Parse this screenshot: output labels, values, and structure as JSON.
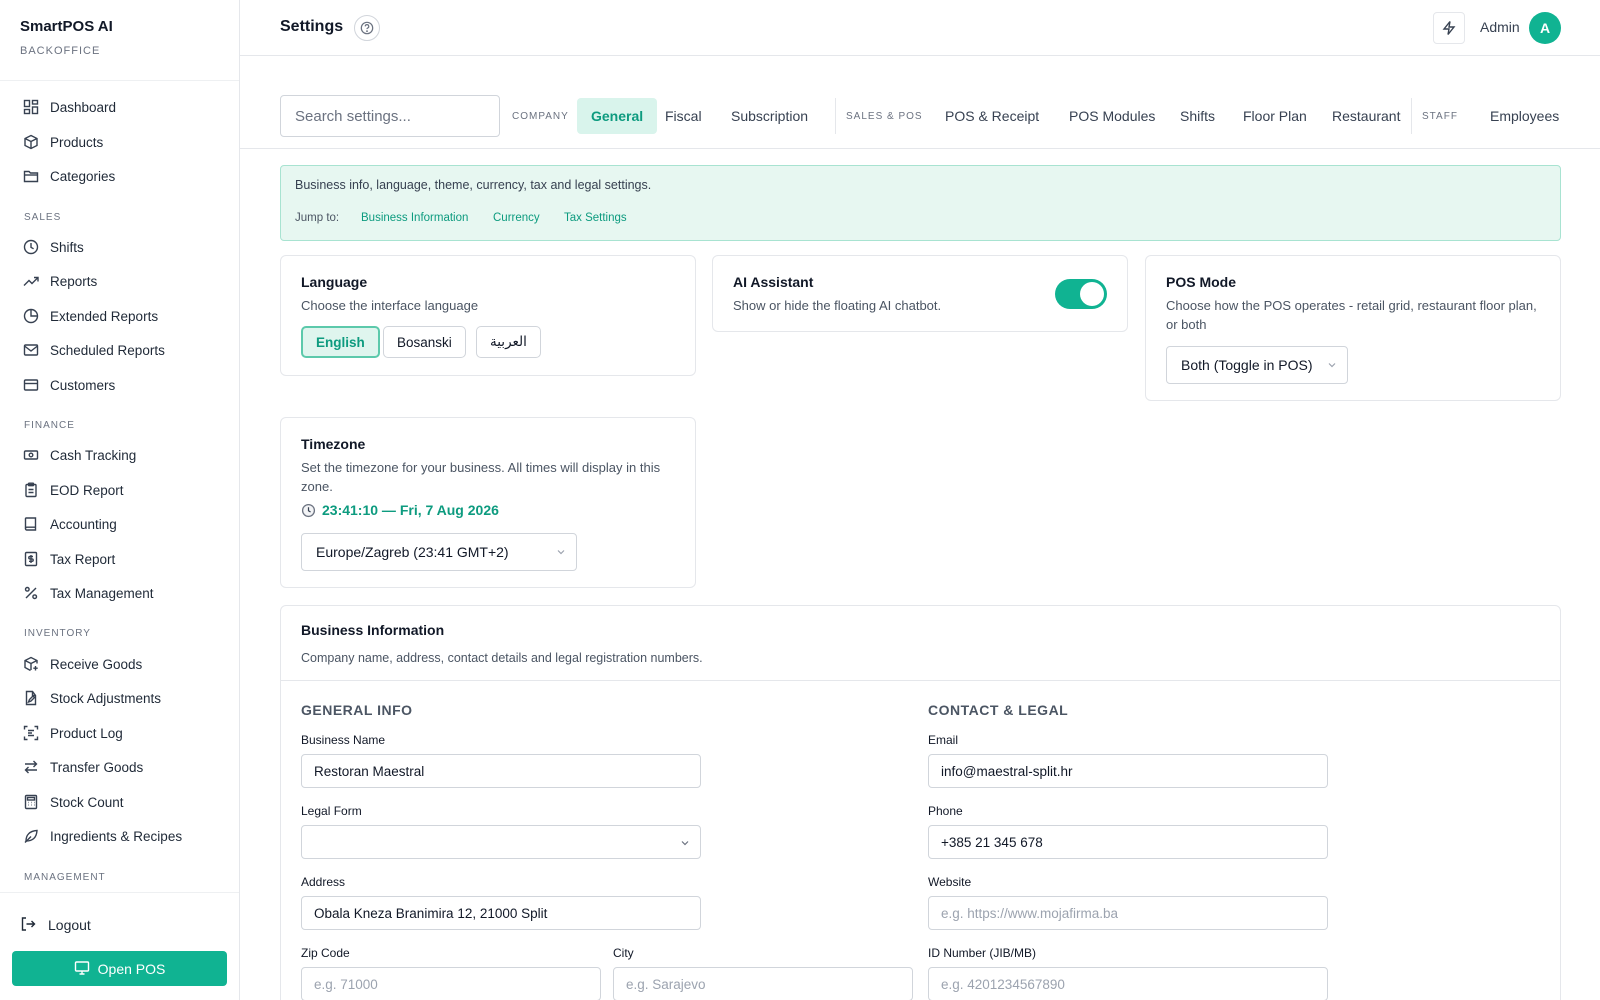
{
  "brand": {
    "title": "SmartPOS AI",
    "subtitle": "BACKOFFICE"
  },
  "sidebar": {
    "items": [
      {
        "label": "Dashboard",
        "icon": "dashboard-icon"
      },
      {
        "label": "Products",
        "icon": "box-icon"
      },
      {
        "label": "Categories",
        "icon": "folder-icon"
      },
      {
        "label": "Shifts",
        "icon": "clock-icon"
      },
      {
        "label": "Reports",
        "icon": "trending-up-icon"
      },
      {
        "label": "Extended Reports",
        "icon": "pie-chart-icon"
      },
      {
        "label": "Scheduled Reports",
        "icon": "mail-icon"
      },
      {
        "label": "Customers",
        "icon": "card-icon"
      },
      {
        "label": "Cash Tracking",
        "icon": "banknote-icon"
      },
      {
        "label": "EOD Report",
        "icon": "clipboard-icon"
      },
      {
        "label": "Accounting",
        "icon": "book-icon"
      },
      {
        "label": "Tax Report",
        "icon": "dollar-file-icon"
      },
      {
        "label": "Tax Management",
        "icon": "percent-icon"
      },
      {
        "label": "Receive Goods",
        "icon": "package-plus-icon"
      },
      {
        "label": "Stock Adjustments",
        "icon": "file-edit-icon"
      },
      {
        "label": "Product Log",
        "icon": "scan-text-icon"
      },
      {
        "label": "Transfer Goods",
        "icon": "arrows-icon"
      },
      {
        "label": "Stock Count",
        "icon": "calculator-icon"
      },
      {
        "label": "Ingredients & Recipes",
        "icon": "leaf-icon"
      }
    ],
    "sections": {
      "sales": "SALES",
      "finance": "FINANCE",
      "inventory": "INVENTORY",
      "management": "MANAGEMENT"
    },
    "logout": "Logout",
    "open_pos": "Open POS"
  },
  "header": {
    "title": "Settings",
    "user": "Admin",
    "avatar_initial": "A"
  },
  "search": {
    "placeholder": "Search settings..."
  },
  "tabs": {
    "company_label": "COMPANY",
    "sales_label": "SALES & POS",
    "staff_label": "STAFF",
    "items": [
      "General",
      "Fiscal",
      "Subscription",
      "POS & Receipt",
      "POS Modules",
      "Shifts",
      "Floor Plan",
      "Restaurant",
      "Employees"
    ],
    "active": "General"
  },
  "banner": {
    "text": "Business info, language, theme, currency, tax and legal settings.",
    "jump_label": "Jump to:",
    "links": [
      "Business Information",
      "Currency",
      "Tax Settings"
    ]
  },
  "language": {
    "title": "Language",
    "desc": "Choose the interface language",
    "options": [
      "English",
      "Bosanski",
      "العربية"
    ],
    "selected": "English"
  },
  "ai": {
    "title": "AI Assistant",
    "desc": "Show or hide the floating AI chatbot.",
    "enabled": true
  },
  "pos_mode": {
    "title": "POS Mode",
    "desc": "Choose how the POS operates - retail grid, restaurant floor plan, or both",
    "value": "Both (Toggle in POS)"
  },
  "timezone": {
    "title": "Timezone",
    "desc": "Set the timezone for your business. All times will display in this zone.",
    "current_time": "23:41:10 — Fri, 7 Aug 2026",
    "value": "Europe/Zagreb (23:41 GMT+2)"
  },
  "business": {
    "title": "Business Information",
    "desc": "Company name, address, contact details and legal registration numbers.",
    "general_head": "GENERAL INFO",
    "contact_head": "CONTACT & LEGAL",
    "fields": {
      "business_name": {
        "label": "Business Name",
        "value": "Restoran Maestral"
      },
      "legal_form": {
        "label": "Legal Form",
        "value": ""
      },
      "address": {
        "label": "Address",
        "value": "Obala Kneza Branimira 12, 21000 Split"
      },
      "zip": {
        "label": "Zip Code",
        "placeholder": "e.g. 71000"
      },
      "city": {
        "label": "City",
        "placeholder": "e.g. Sarajevo"
      },
      "email": {
        "label": "Email",
        "value": "info@maestral-split.hr"
      },
      "phone": {
        "label": "Phone",
        "value": "+385 21 345 678"
      },
      "website": {
        "label": "Website",
        "placeholder": "e.g. https://www.mojafirma.ba"
      },
      "id_number": {
        "label": "ID Number (JIB/MB)",
        "placeholder": "e.g. 4201234567890"
      }
    }
  },
  "colors": {
    "accent": "#10b392",
    "accent_light": "#d9f4ec",
    "banner_bg": "#e7f7f1"
  }
}
